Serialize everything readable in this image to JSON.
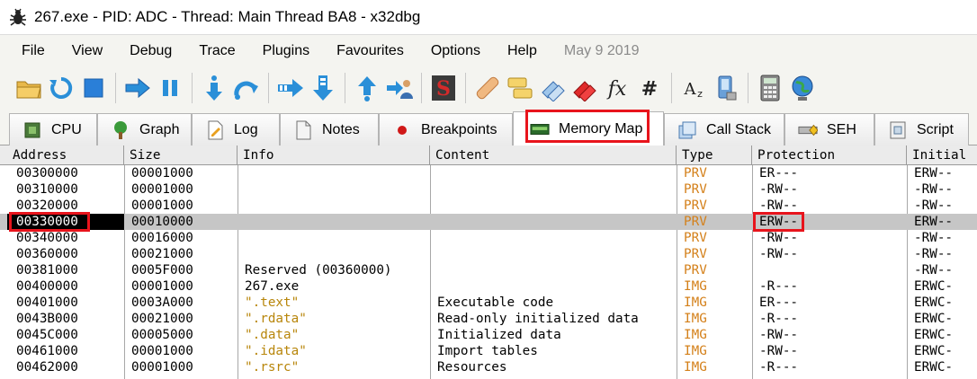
{
  "window": {
    "title": "267.exe - PID: ADC - Thread: Main Thread BA8 - x32dbg",
    "icon": "bug-icon"
  },
  "menu": {
    "items": [
      "File",
      "View",
      "Debug",
      "Trace",
      "Plugins",
      "Favourites",
      "Options",
      "Help"
    ],
    "date": "May 9 2019"
  },
  "toolbar": {
    "buttons": [
      "open-folder-icon",
      "restart-icon",
      "stop-icon",
      "run-icon",
      "pause-icon",
      "step-into-icon",
      "step-over-icon",
      "trace-into-icon",
      "trace-over-icon",
      "execute-till-return-icon",
      "run-to-user-code-icon",
      "scylla-icon",
      "patches-icon",
      "comments-icon",
      "labels-icon",
      "bookmarks-icon",
      "functions-icon",
      "variables-icon",
      "calculator-icon",
      "strings-icon",
      "device-icon",
      "calculator2-icon",
      "globe-icon"
    ]
  },
  "tabs": [
    {
      "label": "CPU",
      "icon": "cpu-icon"
    },
    {
      "label": "Graph",
      "icon": "graph-icon"
    },
    {
      "label": "Log",
      "icon": "log-icon"
    },
    {
      "label": "Notes",
      "icon": "notes-icon"
    },
    {
      "label": "Breakpoints",
      "icon": "breakpoint-icon"
    },
    {
      "label": "Memory Map",
      "icon": "memory-map-icon"
    },
    {
      "label": "Call Stack",
      "icon": "call-stack-icon"
    },
    {
      "label": "SEH",
      "icon": "seh-icon"
    },
    {
      "label": "Script",
      "icon": "script-icon"
    }
  ],
  "table": {
    "headers": [
      "Address",
      "Size",
      "Info",
      "Content",
      "Type",
      "Protection",
      "Initial"
    ],
    "rows": [
      [
        "00300000",
        "00001000",
        "",
        "",
        "PRV",
        "ER---",
        "ERW--"
      ],
      [
        "00310000",
        "00001000",
        "",
        "",
        "PRV",
        "-RW--",
        "-RW--"
      ],
      [
        "00320000",
        "00001000",
        "",
        "",
        "PRV",
        "-RW--",
        "-RW--"
      ],
      [
        "00330000",
        "00010000",
        "",
        "",
        "PRV",
        "ERW--",
        "ERW--"
      ],
      [
        "00340000",
        "00016000",
        "",
        "",
        "PRV",
        "-RW--",
        "-RW--"
      ],
      [
        "00360000",
        "00021000",
        "",
        "",
        "PRV",
        "-RW--",
        "-RW--"
      ],
      [
        "00381000",
        "0005F000",
        "Reserved (00360000)",
        "",
        "PRV",
        "",
        "-RW--"
      ],
      [
        "00400000",
        "00001000",
        "267.exe",
        "",
        "IMG",
        "-R---",
        "ERWC-"
      ],
      [
        "00401000",
        "0003A000",
        " \".text\"",
        "Executable code",
        "IMG",
        "ER---",
        "ERWC-"
      ],
      [
        "0043B000",
        "00021000",
        " \".rdata\"",
        "Read-only initialized data",
        "IMG",
        "-R---",
        "ERWC-"
      ],
      [
        "0045C000",
        "00005000",
        " \".data\"",
        "Initialized data",
        "IMG",
        "-RW--",
        "ERWC-"
      ],
      [
        "00461000",
        "00001000",
        " \".idata\"",
        "Import tables",
        "IMG",
        "-RW--",
        "ERWC-"
      ],
      [
        "00462000",
        "00001000",
        " \".rsrc\"",
        "Resources",
        "IMG",
        "-R---",
        "ERWC-"
      ]
    ],
    "selected_row": 3
  },
  "colors": {
    "highlight": "#e8141c",
    "type_text": "#d4801a",
    "selection": "#c6c6c6"
  }
}
